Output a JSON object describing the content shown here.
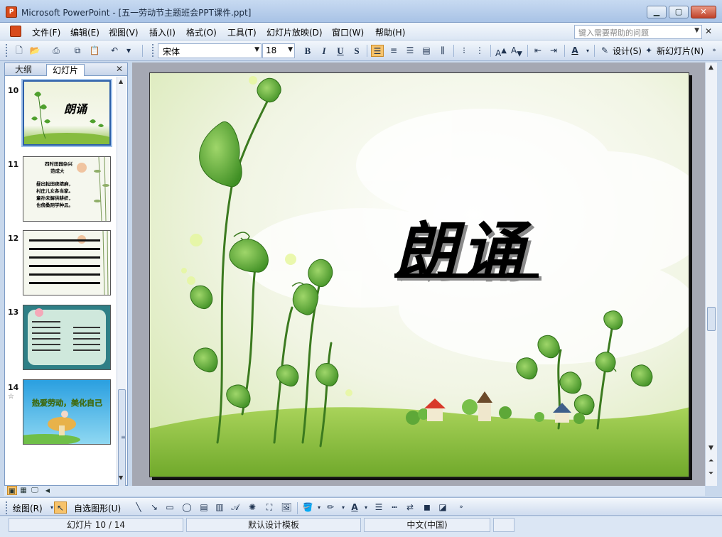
{
  "window": {
    "app_icon_label": "P",
    "title": "Microsoft PowerPoint - [五一劳动节主题班会PPT课件.ppt]",
    "minimize": "▁",
    "maximize": "▢",
    "close": "✕"
  },
  "menu": {
    "items": [
      "文件(F)",
      "编辑(E)",
      "视图(V)",
      "插入(I)",
      "格式(O)",
      "工具(T)",
      "幻灯片放映(D)",
      "窗口(W)",
      "帮助(H)"
    ],
    "help_placeholder": "键入需要帮助的问题",
    "close": "✕"
  },
  "toolbar": {
    "font_name": "宋体",
    "font_size": "18",
    "bold": "B",
    "italic": "I",
    "underline": "U",
    "shadow": "S",
    "design_label": "设计(S)",
    "new_slide_label": "新幻灯片(N)"
  },
  "outline_pane": {
    "tab_outline": "大纲",
    "tab_slides": "幻灯片",
    "close": "✕",
    "thumbnails": [
      {
        "number": "10",
        "title": "朗诵",
        "selected": true
      },
      {
        "number": "11",
        "lines": [
          "四时田园杂兴",
          "范成大",
          "昼出耘田夜绩麻，",
          "村庄儿女各当家。",
          "童孙未解供耕织，",
          "也傍桑阴学种瓜。"
        ]
      },
      {
        "number": "12"
      },
      {
        "number": "13"
      },
      {
        "number": "14",
        "text": "热爱劳动，美化自己",
        "has_transition": true
      }
    ]
  },
  "slide": {
    "title": "朗诵"
  },
  "drawing": {
    "draw_label": "绘图(R)",
    "autoshapes_label": "自选图形(U)"
  },
  "status": {
    "slide_position": "幻灯片 10 / 14",
    "template": "默认设计模板",
    "language": "中文(中国)"
  }
}
